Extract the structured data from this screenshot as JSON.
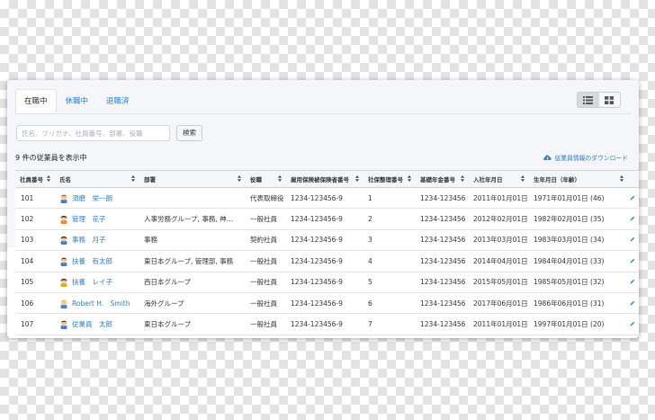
{
  "tabs": [
    {
      "label": "在職中",
      "active": true
    },
    {
      "label": "休職中",
      "active": false
    },
    {
      "label": "退職済",
      "active": false
    }
  ],
  "view_toggle": {
    "list_icon": "list-icon",
    "grid_icon": "grid-icon",
    "active": "list"
  },
  "search": {
    "placeholder": "氏名、フリガナ、社員番号、部署、役職",
    "value": "",
    "button_label": "検索"
  },
  "result_count": "9 件の従業員を表示中",
  "download": {
    "label": "従業員情報のダウンロード",
    "icon": "cloud-download-icon"
  },
  "colors": {
    "accent": "#2f7ec1",
    "header_bg": "#f4f6f9"
  },
  "table": {
    "columns": [
      "社員番号",
      "氏名",
      "部署",
      "役職",
      "雇用保険被保険者番号",
      "社保整理番号",
      "基礎年金番号",
      "入社年月日",
      "生年月日（年齢）"
    ],
    "rows": [
      {
        "id": "101",
        "name": "須磨　栄一朗",
        "dept": "",
        "title": "代表取締役",
        "emp_ins": "1234-123456-9",
        "shaho": "1",
        "pension": "1234-123456",
        "hired": "2011年01月01日",
        "birth": "1971年01月01日 (46)"
      },
      {
        "id": "102",
        "name": "管理　花子",
        "dept": "人事労務グループ, 事務, 神…",
        "title": "一般社員",
        "emp_ins": "1234-123456-9",
        "shaho": "2",
        "pension": "1234-123456",
        "hired": "2012年02月01日",
        "birth": "1982年02月01日 (35)"
      },
      {
        "id": "103",
        "name": "事務　月子",
        "dept": "事務",
        "title": "契約社員",
        "emp_ins": "1234-123456-9",
        "shaho": "3",
        "pension": "1234-123456",
        "hired": "2013年03月01日",
        "birth": "1983年03月01日 (34)"
      },
      {
        "id": "104",
        "name": "扶養　有太郎",
        "dept": "東日本グループ, 管理部, 事務",
        "title": "一般社員",
        "emp_ins": "1234-123456-9",
        "shaho": "4",
        "pension": "1234-123456",
        "hired": "2014年04月01日",
        "birth": "1984年04月01日 (33)"
      },
      {
        "id": "105",
        "name": "扶養　レイ子",
        "dept": "西日本グループ",
        "title": "一般社員",
        "emp_ins": "1234-123456-9",
        "shaho": "5",
        "pension": "1234-123456",
        "hired": "2015年05月01日",
        "birth": "1985年05月01日 (32)"
      },
      {
        "id": "106",
        "name": "Robert H.　Smith",
        "dept": "海外グループ",
        "title": "一般社員",
        "emp_ins": "1234-123456-9",
        "shaho": "6",
        "pension": "1234-123456",
        "hired": "2017年06月01日",
        "birth": "1986年06月01日 (31)"
      },
      {
        "id": "107",
        "name": "従業員　太郎",
        "dept": "東日本グループ",
        "title": "一般社員",
        "emp_ins": "1234-123456-9",
        "shaho": "7",
        "pension": "1234-123456",
        "hired": "2011年01月01日",
        "birth": "1997年01月01日 (20)"
      }
    ]
  }
}
